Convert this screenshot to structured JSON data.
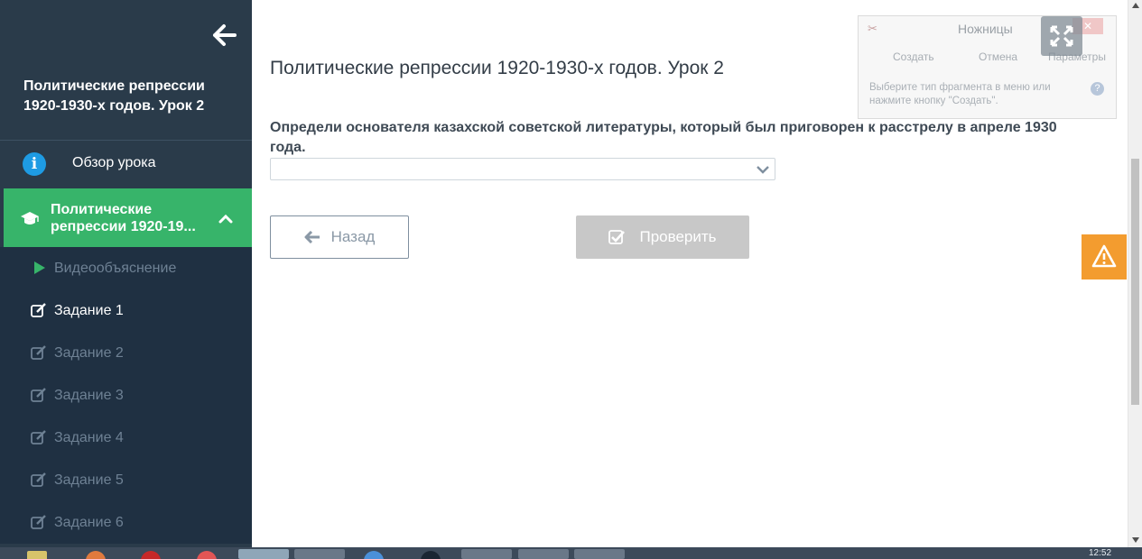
{
  "sidebar": {
    "title": "Политические репрессии 1920-1930-х годов. Урок 2",
    "overview_label": "Обзор урока",
    "active_lesson_label": "Политические репрессии 1920-19...",
    "items": [
      {
        "label": "Видеообъяснение",
        "icon": "play-icon"
      },
      {
        "label": "Задание 1",
        "icon": "edit-icon"
      },
      {
        "label": "Задание 2",
        "icon": "edit-icon"
      },
      {
        "label": "Задание 3",
        "icon": "edit-icon"
      },
      {
        "label": "Задание 4",
        "icon": "edit-icon"
      },
      {
        "label": "Задание 5",
        "icon": "edit-icon"
      },
      {
        "label": "Задание 6",
        "icon": "edit-icon"
      }
    ]
  },
  "main": {
    "title": "Политические репрессии 1920-1930-х годов. Урок 2",
    "question": "Определи основателя казахской советской литературы, который был приговорен к расстрелу в апреле 1930 года.",
    "select_value": "",
    "back_label": "Назад",
    "check_label": "Проверить"
  },
  "snipping_tool": {
    "title": "Ножницы",
    "create_label": "Создать",
    "cancel_label": "Отмена",
    "params_label": "Параметры",
    "message": "Выберите тип фрагмента в меню или нажмите кнопку \"Создать\"."
  },
  "taskbar": {
    "clock": "12:52"
  },
  "colors": {
    "sidebar_bg": "#2a3b4a",
    "accent_green": "#37b46a",
    "info_blue": "#1e9be3",
    "warning_orange": "#f39c2f",
    "disabled_button": "#c8c8c8"
  }
}
